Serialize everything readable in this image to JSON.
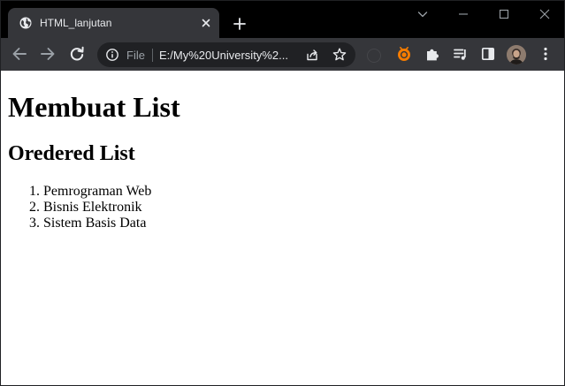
{
  "tab": {
    "title": "HTML_lanjutan",
    "favicon": "globe-icon",
    "close_icon": "close-icon"
  },
  "new_tab_icon": "plus-icon",
  "window_controls": [
    "tab-search-icon",
    "minimize-icon",
    "maximize-icon",
    "close-window-icon"
  ],
  "toolbar": {
    "back_icon": "arrow-left-icon",
    "forward_icon": "arrow-right-icon",
    "reload_icon": "reload-icon",
    "omnibox": {
      "info_icon": "info-icon",
      "scheme": "File",
      "url": "E:/My%20University%2...",
      "share_icon": "share-icon",
      "bookmark_icon": "star-icon"
    },
    "extensions": [
      "faded-extension-icon",
      "orange-extension-icon",
      "puzzle-icon",
      "media-queue-icon",
      "side-panel-icon"
    ],
    "profile_icon": "avatar",
    "menu_icon": "kebab-menu-icon"
  },
  "colors": {
    "tabstrip_bg": "#000000",
    "toolbar_bg": "#35363a",
    "omnibox_bg": "#202124",
    "icon": "#e8eaed",
    "extension_accent": "#f57c00",
    "page_bg": "#ffffff"
  },
  "page": {
    "heading": "Membuat List",
    "subheading": "Oredered List",
    "list_items": [
      "Pemrograman Web",
      "Bisnis Elektronik",
      "Sistem Basis Data"
    ]
  }
}
